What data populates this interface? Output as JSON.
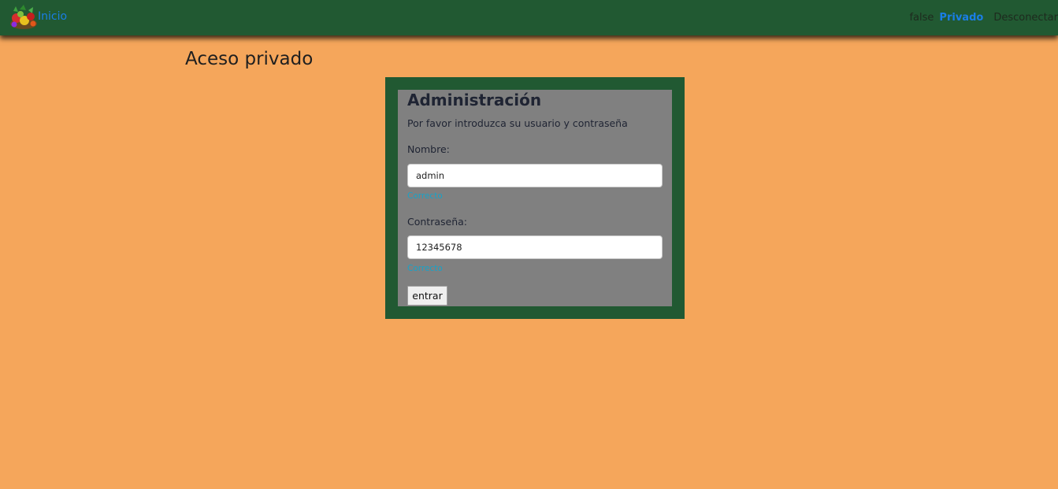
{
  "navbar": {
    "brand_label": "Inicio",
    "logo_icon": "fruit-vegetable-basket-icon",
    "status_text": "false",
    "private_link": "Privado",
    "logout_link": "Desconectar"
  },
  "page": {
    "title": "Aceso privado"
  },
  "login": {
    "title": "Administración",
    "subtitle": "Por favor introduzca su usuario y contraseña",
    "username": {
      "label": "Nombre:",
      "value": "admin",
      "validation": "Correcto"
    },
    "password": {
      "label": "Contraseña:",
      "value": "12345678",
      "validation": "Correcto"
    },
    "submit_label": "entrar"
  },
  "colors": {
    "page_background": "#f5a65b",
    "navbar_background": "#215932",
    "panel_background": "#808080",
    "link_blue": "#1a7ee6",
    "validation_cyan": "#17a2c8"
  }
}
